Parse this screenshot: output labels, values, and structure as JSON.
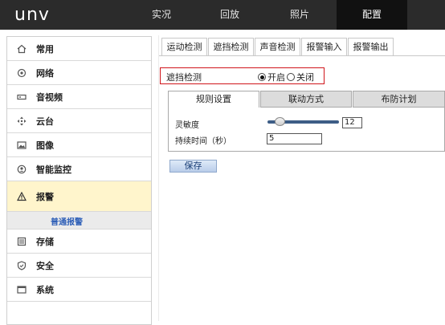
{
  "header": {
    "logo": "unv",
    "nav": [
      {
        "label": "实况",
        "active": false
      },
      {
        "label": "回放",
        "active": false
      },
      {
        "label": "照片",
        "active": false
      },
      {
        "label": "配置",
        "active": true
      }
    ]
  },
  "sidebar": {
    "items": [
      {
        "label": "常用",
        "icon": "home-icon"
      },
      {
        "label": "网络",
        "icon": "globe-icon"
      },
      {
        "label": "音视频",
        "icon": "media-icon"
      },
      {
        "label": "云台",
        "icon": "ptz-icon"
      },
      {
        "label": "图像",
        "icon": "image-icon"
      },
      {
        "label": "智能监控",
        "icon": "smart-monitor-icon"
      },
      {
        "label": "报警",
        "icon": "warning-icon"
      },
      {
        "label": "存储",
        "icon": "storage-icon"
      },
      {
        "label": "安全",
        "icon": "shield-icon"
      },
      {
        "label": "系统",
        "icon": "system-icon"
      }
    ],
    "active_index": 6,
    "sub_item": "普通报警"
  },
  "tabs": [
    {
      "label": "运动检测",
      "active": false
    },
    {
      "label": "遮挡检测",
      "active": true
    },
    {
      "label": "声音检测",
      "active": false
    },
    {
      "label": "报警输入",
      "active": false
    },
    {
      "label": "报警输出",
      "active": false
    }
  ],
  "detection": {
    "label": "遮挡检测",
    "on_label": "开启",
    "off_label": "关闭",
    "selected": "开启"
  },
  "subtabs": [
    {
      "label": "规则设置",
      "active": true
    },
    {
      "label": "联动方式",
      "active": false
    },
    {
      "label": "布防计划",
      "active": false
    }
  ],
  "settings": {
    "sensitivity_label": "灵敏度",
    "sensitivity_value": "12",
    "sensitivity_fraction": 0.12,
    "duration_label": "持续时间（秒）",
    "duration_value": "5"
  },
  "save_label": "保存",
  "colors": {
    "header_bg": "#2b2b2b",
    "active_nav_bg": "#111111",
    "highlight_border": "#d0151b",
    "active_item_bg": "#fff5cc",
    "slider": "#3d5d86",
    "link_blue": "#2e5fb7"
  }
}
